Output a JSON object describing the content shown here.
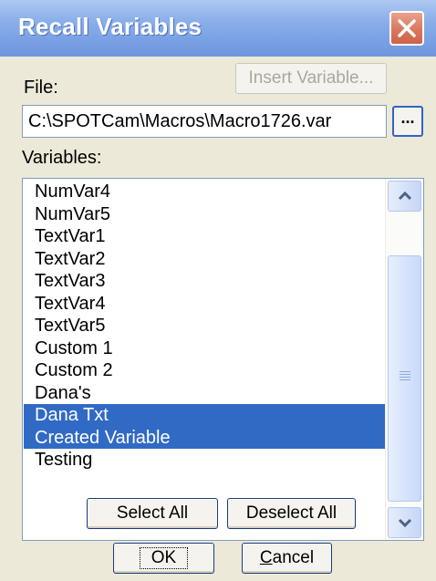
{
  "window": {
    "title": "Recall Variables",
    "close_icon": "close-icon"
  },
  "file": {
    "label": "File:",
    "insert_button_label": "Insert Variable...",
    "path_value": "C:\\SPOTCam\\Macros\\Macro1726.var",
    "browse_label": "..."
  },
  "variables": {
    "label": "Variables:",
    "items": [
      {
        "label": "NumVar4",
        "selected": false
      },
      {
        "label": "NumVar5",
        "selected": false
      },
      {
        "label": "TextVar1",
        "selected": false
      },
      {
        "label": "TextVar2",
        "selected": false
      },
      {
        "label": "TextVar3",
        "selected": false
      },
      {
        "label": "TextVar4",
        "selected": false
      },
      {
        "label": "TextVar5",
        "selected": false
      },
      {
        "label": "Custom 1",
        "selected": false
      },
      {
        "label": "Custom 2",
        "selected": false
      },
      {
        "label": "Dana's",
        "selected": false
      },
      {
        "label": "Dana Txt",
        "selected": true
      },
      {
        "label": "Created Variable",
        "selected": true
      },
      {
        "label": "Testing",
        "selected": false
      }
    ]
  },
  "buttons": {
    "select_all": "Select All",
    "deselect_all": "Deselect All",
    "ok": "OK",
    "cancel": "Cancel"
  },
  "colors": {
    "selection": "#316ac5",
    "title_bar": "#7aa1e4",
    "close_button": "#d9775d",
    "dialog_background": "#ece9d8"
  }
}
